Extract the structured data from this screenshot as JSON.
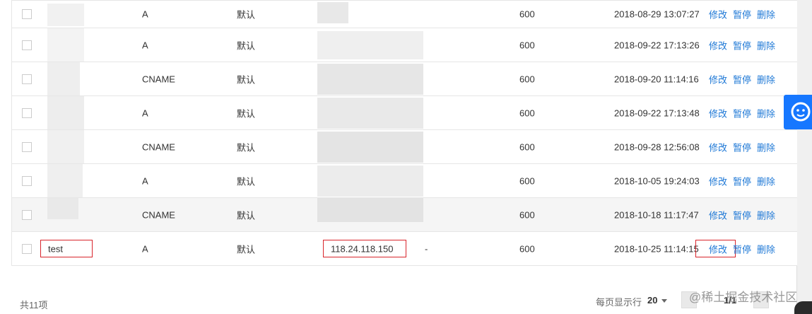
{
  "rows": [
    {
      "type": "A",
      "line": "默认",
      "value": "",
      "dash": "",
      "ttl": "600",
      "time": "2018-08-29 13:07:27"
    },
    {
      "type": "A",
      "line": "默认",
      "value": "",
      "dash": "",
      "ttl": "600",
      "time": "2018-09-22 17:13:26"
    },
    {
      "type": "CNAME",
      "line": "默认",
      "value": "",
      "dash": "",
      "ttl": "600",
      "time": "2018-09-20 11:14:16"
    },
    {
      "type": "A",
      "line": "默认",
      "value": "",
      "dash": "",
      "ttl": "600",
      "time": "2018-09-22 17:13:48"
    },
    {
      "type": "CNAME",
      "line": "默认",
      "value": "",
      "dash": "",
      "ttl": "600",
      "time": "2018-09-28 12:56:08"
    },
    {
      "type": "A",
      "line": "默认",
      "value": "",
      "dash": "",
      "ttl": "600",
      "time": "2018-10-05 19:24:03"
    },
    {
      "type": "CNAME",
      "line": "默认",
      "value": "",
      "dash": "",
      "ttl": "600",
      "time": "2018-10-18 11:17:47"
    },
    {
      "host": "test",
      "type": "A",
      "line": "默认",
      "value": "118.24.118.150",
      "dash": "-",
      "ttl": "600",
      "time": "2018-10-25 11:14:15"
    }
  ],
  "ops": {
    "edit": "修改",
    "pause": "暂停",
    "delete": "删除"
  },
  "footer": {
    "total": "共11项",
    "per_page_label": "每页显示行",
    "per_page_value": "20",
    "pages": "1/1"
  },
  "watermark": "@稀土掘金技术社区",
  "colors": {
    "link": "#1e78d6",
    "highlight_box": "#d9242b",
    "help_button": "#1677ff"
  },
  "icons": {
    "help": "headset-smile-icon"
  }
}
